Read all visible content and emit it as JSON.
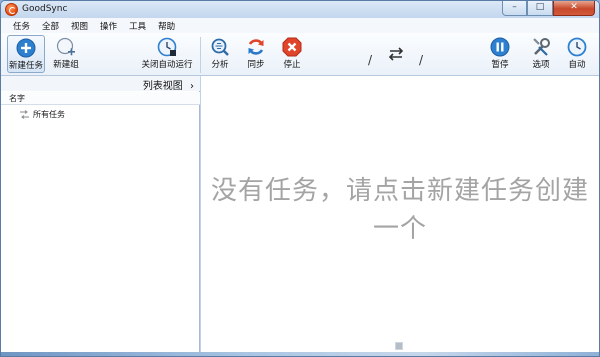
{
  "window": {
    "title": "GoodSync",
    "minimize": "–",
    "maximize": "□",
    "close": "✕"
  },
  "menu": [
    "任务",
    "全部",
    "视图",
    "操作",
    "工具",
    "帮助"
  ],
  "toolbar": {
    "new_job": "新建任务",
    "new_group": "新建组",
    "auto_run_off": "关闭自动运行",
    "analyze": "分析",
    "sync": "同步",
    "stop": "停止",
    "slash_left": "/",
    "slash_right": "/",
    "pause": "暂停",
    "options": "选项",
    "auto": "自动"
  },
  "left_panel": {
    "list_view_label": "列表视图",
    "list_view_chevron": "›",
    "column_name": "名字",
    "tree_all_jobs": "所有任务"
  },
  "main": {
    "empty_message": "没有任务，请点击新建任务创建一个"
  },
  "colors": {
    "accent_blue": "#2d7fd0",
    "sync_arrows": "#2a78c9",
    "stop_red": "#e0442a",
    "message_gray": "#a4a4a4"
  }
}
